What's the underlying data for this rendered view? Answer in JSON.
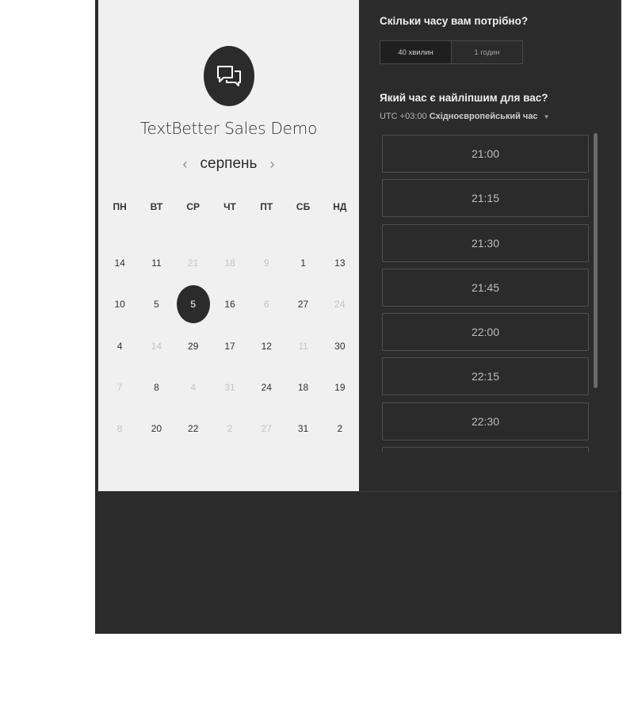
{
  "event": {
    "title": "TextBetter Sales Demo",
    "icon": "chat-bubbles-icon"
  },
  "calendar": {
    "month": "серпень",
    "prev_arrow": "‹",
    "next_arrow": "›",
    "weekdays": [
      "ПН",
      "ВТ",
      "СР",
      "ЧТ",
      "ПТ",
      "СБ",
      "НД"
    ],
    "days": [
      {
        "label": "14",
        "muted": false
      },
      {
        "label": "11",
        "muted": false
      },
      {
        "label": "21",
        "muted": true
      },
      {
        "label": "18",
        "muted": true
      },
      {
        "label": "9",
        "muted": true
      },
      {
        "label": "1",
        "muted": false
      },
      {
        "label": "13",
        "muted": false
      },
      {
        "label": "10",
        "muted": false
      },
      {
        "label": "5",
        "muted": false
      },
      {
        "label": "5",
        "muted": false,
        "selected": true
      },
      {
        "label": "16",
        "muted": false
      },
      {
        "label": "6",
        "muted": true
      },
      {
        "label": "27",
        "muted": false
      },
      {
        "label": "24",
        "muted": true
      },
      {
        "label": "4",
        "muted": false
      },
      {
        "label": "14",
        "muted": true
      },
      {
        "label": "29",
        "muted": false
      },
      {
        "label": "17",
        "muted": false
      },
      {
        "label": "12",
        "muted": false
      },
      {
        "label": "11",
        "muted": true
      },
      {
        "label": "30",
        "muted": false
      },
      {
        "label": "7",
        "muted": true
      },
      {
        "label": "8",
        "muted": false
      },
      {
        "label": "4",
        "muted": true
      },
      {
        "label": "31",
        "muted": true
      },
      {
        "label": "24",
        "muted": false
      },
      {
        "label": "18",
        "muted": false
      },
      {
        "label": "19",
        "muted": false
      },
      {
        "label": "8",
        "muted": true
      },
      {
        "label": "20",
        "muted": false
      },
      {
        "label": "22",
        "muted": false
      },
      {
        "label": "2",
        "muted": true
      },
      {
        "label": "27",
        "muted": true
      },
      {
        "label": "31",
        "muted": false
      },
      {
        "label": "2",
        "muted": false
      }
    ]
  },
  "booking": {
    "duration_question": "Скільки часу вам потрібно?",
    "duration_options": [
      {
        "label": "40 хвилин",
        "active": true
      },
      {
        "label": "1 годин",
        "active": false
      }
    ],
    "time_question": "Який час є найліпшим для вас?",
    "timezone_offset": "UTC +03:00",
    "timezone_name": "Східноєвропейський час",
    "timezone_caret": "▼",
    "slots": [
      "21:00",
      "21:15",
      "21:30",
      "21:45",
      "22:00",
      "22:15",
      "22:30",
      ""
    ]
  },
  "colors": {
    "dark": "#2b2b2b",
    "light_panel": "#f0f0f0"
  }
}
